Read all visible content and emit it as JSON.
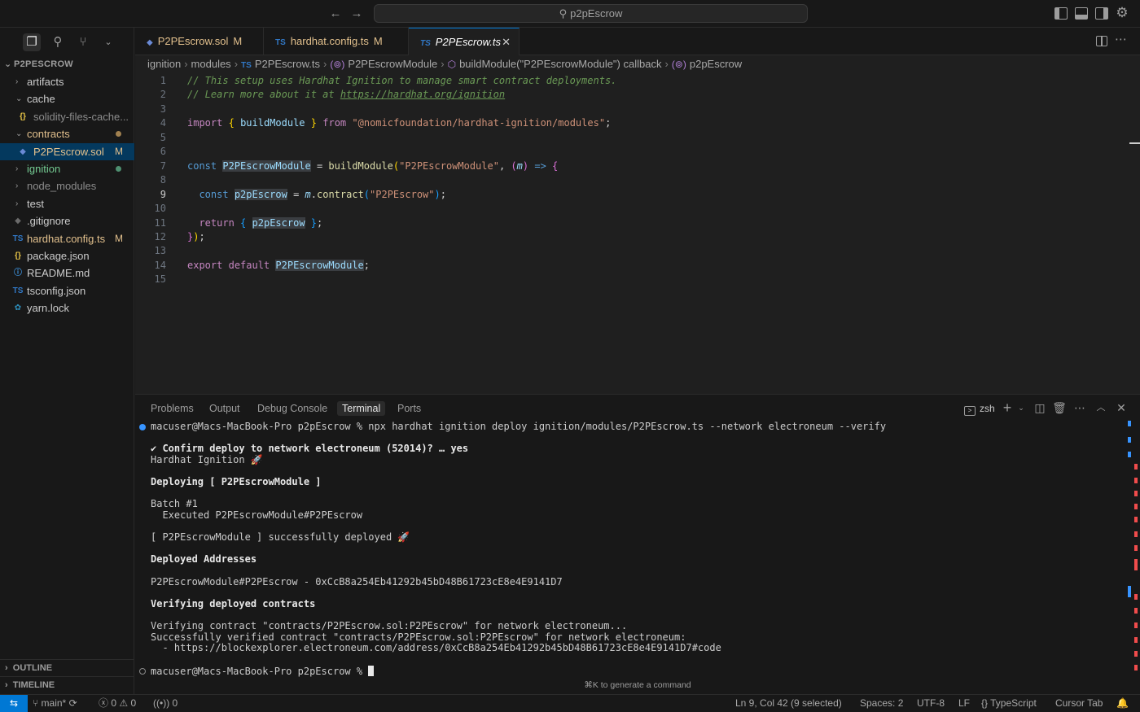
{
  "titlebar": {
    "search_text": "p2pEscrow",
    "icons": [
      "arrow-left-icon",
      "arrow-right-icon",
      "search-icon",
      "toggle-primary-sidebar-icon",
      "toggle-panel-icon",
      "toggle-secondary-sidebar-icon",
      "gear-icon"
    ]
  },
  "sidebar": {
    "header": "P2PESCROW",
    "tree": [
      {
        "label": "artifacts",
        "type": "folder",
        "expanded": false,
        "depth": 1
      },
      {
        "label": "cache",
        "type": "folder",
        "expanded": true,
        "depth": 1
      },
      {
        "label": "solidity-files-cache...",
        "type": "json",
        "icon": "{}",
        "depth": 2
      },
      {
        "label": "contracts",
        "type": "folder",
        "expanded": true,
        "depth": 1,
        "status_dot": "#a0804f"
      },
      {
        "label": "P2PEscrow.sol",
        "type": "sol",
        "icon": "◆",
        "depth": 2,
        "status": "M",
        "selected": true
      },
      {
        "label": "ignition",
        "type": "folder",
        "expanded": false,
        "depth": 1,
        "status_dot": "#4e8f70"
      },
      {
        "label": "node_modules",
        "type": "folder",
        "expanded": false,
        "depth": 1
      },
      {
        "label": "test",
        "type": "folder",
        "expanded": false,
        "depth": 1
      },
      {
        "label": ".gitignore",
        "type": "git",
        "icon": "◆",
        "depth": 1
      },
      {
        "label": "hardhat.config.ts",
        "type": "ts",
        "icon": "TS",
        "depth": 1,
        "status": "M"
      },
      {
        "label": "package.json",
        "type": "json",
        "icon": "{}",
        "depth": 1
      },
      {
        "label": "README.md",
        "type": "info",
        "icon": "ⓘ",
        "depth": 1
      },
      {
        "label": "tsconfig.json",
        "type": "tsjson",
        "icon": "TS",
        "depth": 1
      },
      {
        "label": "yarn.lock",
        "type": "yarn",
        "icon": "✿",
        "depth": 1
      }
    ],
    "outline": "OUTLINE",
    "timeline": "TIMELINE"
  },
  "tabs": [
    {
      "label": "P2PEscrow.sol",
      "icon": "◆",
      "status": "M"
    },
    {
      "label": "hardhat.config.ts",
      "icon": "TS",
      "status": "M"
    },
    {
      "label": "P2PEscrow.ts",
      "icon": "TS",
      "active": true
    }
  ],
  "breadcrumb": [
    {
      "text": "ignition"
    },
    {
      "text": "modules"
    },
    {
      "text": "P2PEscrow.ts",
      "icon": "TS"
    },
    {
      "text": "P2PEscrowModule",
      "icon": "(⊚)"
    },
    {
      "text": "buildModule(\"P2PEscrowModule\") callback",
      "icon": "⬡"
    },
    {
      "text": "p2pEscrow",
      "icon": "(⊚)"
    }
  ],
  "editor": {
    "active_line": 9,
    "lines": [
      [
        [
          "cm",
          "// This setup uses Hardhat Ignition to manage smart contract deployments."
        ]
      ],
      [
        [
          "cm",
          "// Learn more about it at "
        ],
        [
          "cm tk-ln",
          "https://hardhat.org/ignition"
        ]
      ],
      [],
      [
        [
          "kw",
          "import"
        ],
        [
          "",
          " "
        ],
        [
          "br",
          "{"
        ],
        [
          "",
          " "
        ],
        [
          "vr",
          "buildModule"
        ],
        [
          "",
          " "
        ],
        [
          "br",
          "}"
        ],
        [
          "",
          " "
        ],
        [
          "kw",
          "from"
        ],
        [
          "",
          " "
        ],
        [
          "st",
          "\"@nomicfoundation/hardhat-ignition/modules\""
        ],
        [
          "",
          ";"
        ]
      ],
      [],
      [],
      [
        [
          "sk",
          "const"
        ],
        [
          "",
          " "
        ],
        [
          "vr hl",
          "P2PEscrowModule"
        ],
        [
          "",
          " = "
        ],
        [
          "fn",
          "buildModule"
        ],
        [
          "br",
          "("
        ],
        [
          "st",
          "\"P2PEscrowModule\""
        ],
        [
          "",
          ", "
        ],
        [
          "bp",
          "("
        ],
        [
          "pm",
          "m"
        ],
        [
          "bp",
          ")"
        ],
        [
          "",
          " "
        ],
        [
          "sk",
          "=>"
        ],
        [
          "",
          " "
        ],
        [
          "bp",
          "{"
        ]
      ],
      [],
      [
        [
          "",
          "  "
        ],
        [
          "sk",
          "const"
        ],
        [
          "",
          " "
        ],
        [
          "vr hl",
          "p2pEscrow"
        ],
        [
          "",
          " = "
        ],
        [
          "pm",
          "m"
        ],
        [
          "",
          "."
        ],
        [
          "fn",
          "contract"
        ],
        [
          "bb",
          "("
        ],
        [
          "st",
          "\"P2PEscrow\""
        ],
        [
          "bb",
          ")"
        ],
        [
          "",
          ";"
        ]
      ],
      [],
      [
        [
          "",
          "  "
        ],
        [
          "kw",
          "return"
        ],
        [
          "",
          " "
        ],
        [
          "bb",
          "{"
        ],
        [
          "",
          " "
        ],
        [
          "vr hl",
          "p2pEscrow"
        ],
        [
          "",
          " "
        ],
        [
          "bb",
          "}"
        ],
        [
          "",
          ";"
        ]
      ],
      [
        [
          "bp",
          "}"
        ],
        [
          "br",
          ")"
        ],
        [
          "",
          ";"
        ]
      ],
      [],
      [
        [
          "kw",
          "export"
        ],
        [
          "",
          " "
        ],
        [
          "kw",
          "default"
        ],
        [
          "",
          " "
        ],
        [
          "vr hl",
          "P2PEscrowModule"
        ],
        [
          "",
          ";"
        ]
      ],
      []
    ]
  },
  "panel": {
    "tabs": [
      "Problems",
      "Output",
      "Debug Console",
      "Terminal",
      "Ports"
    ],
    "active_tab": "Terminal",
    "profile": "zsh",
    "hint": "⌘K to generate a command",
    "terminal_lines": [
      {
        "row": 0,
        "text": "macuser@Macs-MacBook-Pro p2pEscrow % npx hardhat ignition deploy ignition/modules/P2PEscrow.ts --network electroneum --verify",
        "dot": "#3794ff"
      },
      {
        "row": 2,
        "text": "✔ Confirm deploy to network electroneum (52014)? … yes",
        "bold": true
      },
      {
        "row": 3,
        "text": "Hardhat Ignition 🚀"
      },
      {
        "row": 5,
        "text": "Deploying [ P2PEscrowModule ]",
        "bold": true
      },
      {
        "row": 7,
        "text": "Batch #1"
      },
      {
        "row": 8,
        "text": "  Executed P2PEscrowModule#P2PEscrow"
      },
      {
        "row": 10,
        "text": "[ P2PEscrowModule ] successfully deployed 🚀"
      },
      {
        "row": 12,
        "text": "Deployed Addresses",
        "bold": true
      },
      {
        "row": 14,
        "text": "P2PEscrowModule#P2PEscrow - 0xCcB8a254Eb41292b45bD48B61723cE8e4E9141D7"
      },
      {
        "row": 16,
        "text": "Verifying deployed contracts",
        "bold": true
      },
      {
        "row": 18,
        "text": "Verifying contract \"contracts/P2PEscrow.sol:P2PEscrow\" for network electroneum..."
      },
      {
        "row": 19,
        "text": "Successfully verified contract \"contracts/P2PEscrow.sol:P2PEscrow\" for network electroneum:"
      },
      {
        "row": 20,
        "text": "  - https://blockexplorer.electroneum.com/address/0xCcB8a254Eb41292b45bD48B61723cE8e4E9141D7#code"
      },
      {
        "row": 22,
        "text": "macuser@Macs-MacBook-Pro p2pEscrow % ",
        "dot": "hollow",
        "cursor": true
      }
    ]
  },
  "statusbar": {
    "remote": "⇆",
    "branch": "main*",
    "sync": "⟳",
    "errors": "0",
    "warnings": "0",
    "ports": "0",
    "position": "Ln 9, Col 42 (9 selected)",
    "spaces": "Spaces: 2",
    "encoding": "UTF-8",
    "eol": "LF",
    "language": "TypeScript",
    "cursor_tab": "Cursor Tab",
    "notifications": "🔔"
  },
  "colors": {
    "accent": "#0078d4",
    "modified": "#e2c08d",
    "ts_icon": "#3178c6",
    "sol_icon": "#6a8ad6",
    "json_icon": "#e8c547"
  }
}
